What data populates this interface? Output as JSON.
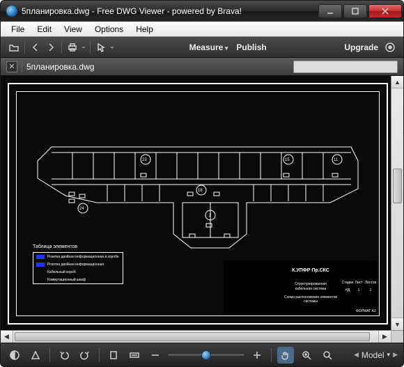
{
  "window": {
    "title": "5планировка.dwg - Free DWG Viewer - powered by Brava!"
  },
  "menu": {
    "file": "File",
    "edit": "Edit",
    "view": "View",
    "options": "Options",
    "help": "Help"
  },
  "toolbar": {
    "measure": "Measure",
    "publish": "Publish",
    "upgrade": "Upgrade"
  },
  "tab": {
    "filename": "5планировка.dwg"
  },
  "drawing": {
    "legend_title": "Таблица элементов",
    "room_labels": [
      "23",
      "15",
      "11",
      "18",
      "24",
      "2"
    ],
    "titleblock": {
      "project": "К.УПФР Пр.СКС",
      "system_line1": "Структурированная",
      "system_line2": "кабельная система",
      "desc_line1": "Схема расположения элементов",
      "desc_line2": "системы",
      "col_stage": "Стадия",
      "col_sheet": "Лист",
      "col_sheets": "Листов",
      "val_stage": "НД",
      "val_sheet": "1",
      "val_sheets": "1",
      "format": "ФОРМАТ   А3"
    },
    "legend_rows": [
      "Розетка двойная информационная в коробе",
      "Розетка двойная информационная",
      "Кабельный короб",
      "Коммутационный шкаф"
    ]
  },
  "bottom": {
    "layout_selector": "Model"
  },
  "colors": {
    "accent_marker": "#2235ff"
  }
}
